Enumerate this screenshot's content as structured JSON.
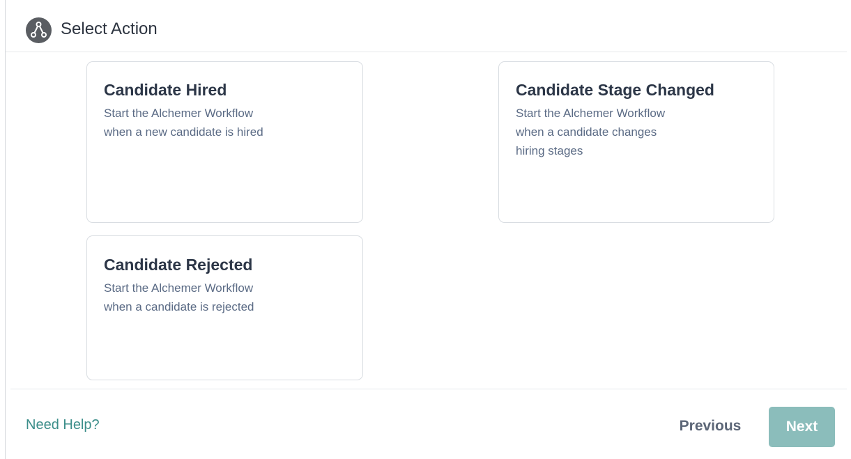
{
  "header": {
    "title": "Select Action",
    "icon": "workflow-nodes-icon"
  },
  "actions": [
    {
      "title": "Candidate Hired",
      "description": [
        "Start the Alchemer Workflow",
        "when a new candidate is hired"
      ]
    },
    {
      "title": "Candidate Stage Changed",
      "description": [
        "Start the Alchemer Workflow",
        "when a candidate changes",
        "hiring stages"
      ]
    },
    {
      "title": "Candidate Rejected",
      "description": [
        "Start the Alchemer Workflow",
        "when a candidate is rejected"
      ]
    }
  ],
  "footer": {
    "help_label": "Need Help?",
    "previous_label": "Previous",
    "next_label": "Next"
  },
  "colors": {
    "accent": "#3c8e8a",
    "next_button_bg": "#8bbdbb",
    "card_border": "#d9dde2",
    "title_text": "#2c3647",
    "description_text": "#5b6b85"
  }
}
